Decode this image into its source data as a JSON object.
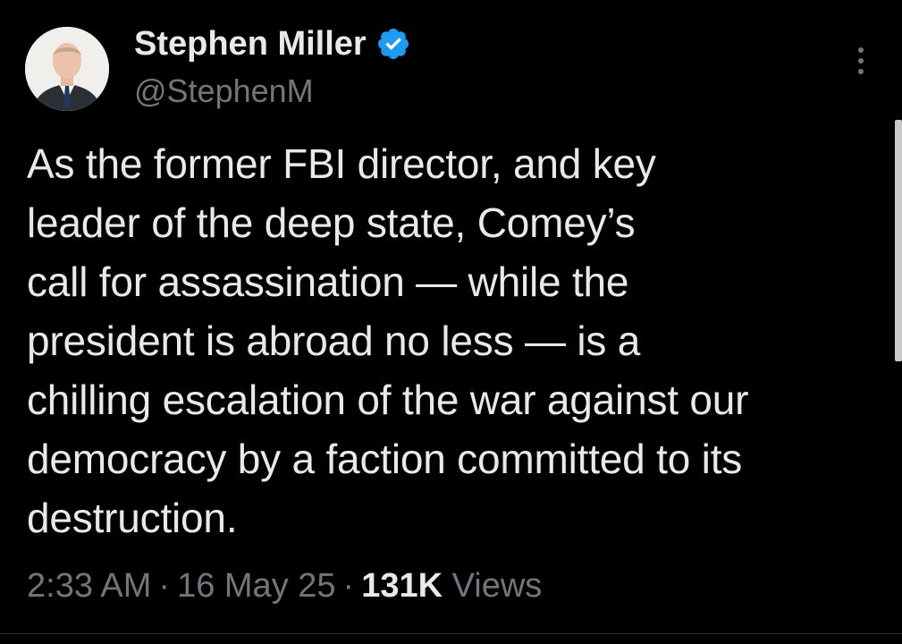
{
  "author": {
    "name": "Stephen Miller",
    "handle": "@StephenM",
    "verified": true,
    "verified_color": "#1d9bf0"
  },
  "tweet": {
    "text": "As the former FBI director, and key\nleader of the deep state, Comey’s\ncall for assassination — while the\npresident is abroad no less — is a\nchilling escalation of the war against our\ndemocracy by a faction committed to its\ndestruction."
  },
  "meta": {
    "time": "2:33 AM",
    "separator": "·",
    "date": "16 May 25",
    "views_count": "131K",
    "views_label": "Views"
  },
  "icons": {
    "more": "more-vertical-icon",
    "verified": "verified-badge-icon"
  },
  "colors": {
    "background": "#000000",
    "text": "#e7e9ea",
    "muted": "#71767b"
  }
}
